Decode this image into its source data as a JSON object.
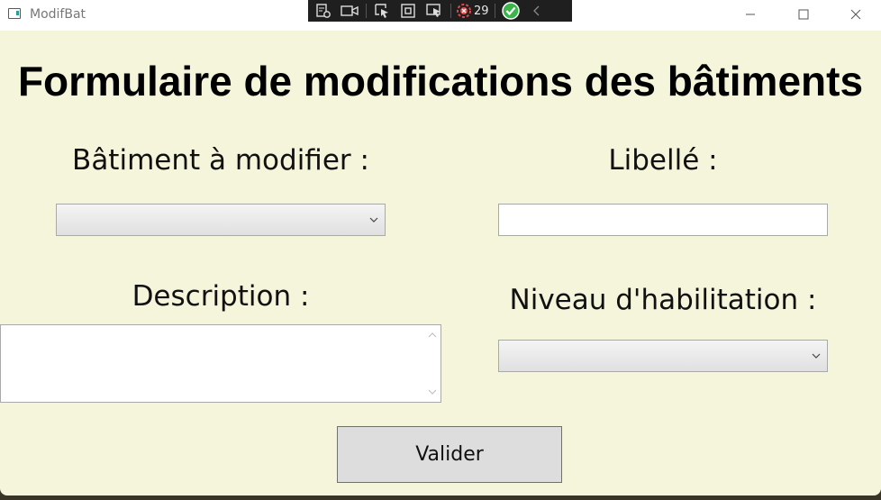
{
  "window": {
    "title": "ModifBat",
    "icon": "app-window-icon",
    "controls": [
      "minimize-icon",
      "maximize-icon",
      "close-icon"
    ]
  },
  "debug_toolbar": {
    "icons": [
      "live-visual-tree-icon",
      "record-icon",
      "select-element-icon",
      "display-layout-adorners-icon",
      "track-focus-icon",
      "error-badge-icon",
      "hot-reload-ok-icon",
      "collapse-chevron-icon"
    ],
    "error_count": "29"
  },
  "form": {
    "heading": "Formulaire de modifications des bâtiments",
    "batiment_label": "Bâtiment à modifier :",
    "batiment_value": "",
    "libelle_label": "Libellé :",
    "libelle_value": "",
    "description_label": "Description :",
    "description_value": "",
    "niveau_label": "Niveau d'habilitation :",
    "niveau_value": "",
    "submit_label": "Valider"
  },
  "colors": {
    "window_background": "#f5f5dc",
    "title_bar": "#ffffff",
    "button_background": "#dddddd"
  }
}
